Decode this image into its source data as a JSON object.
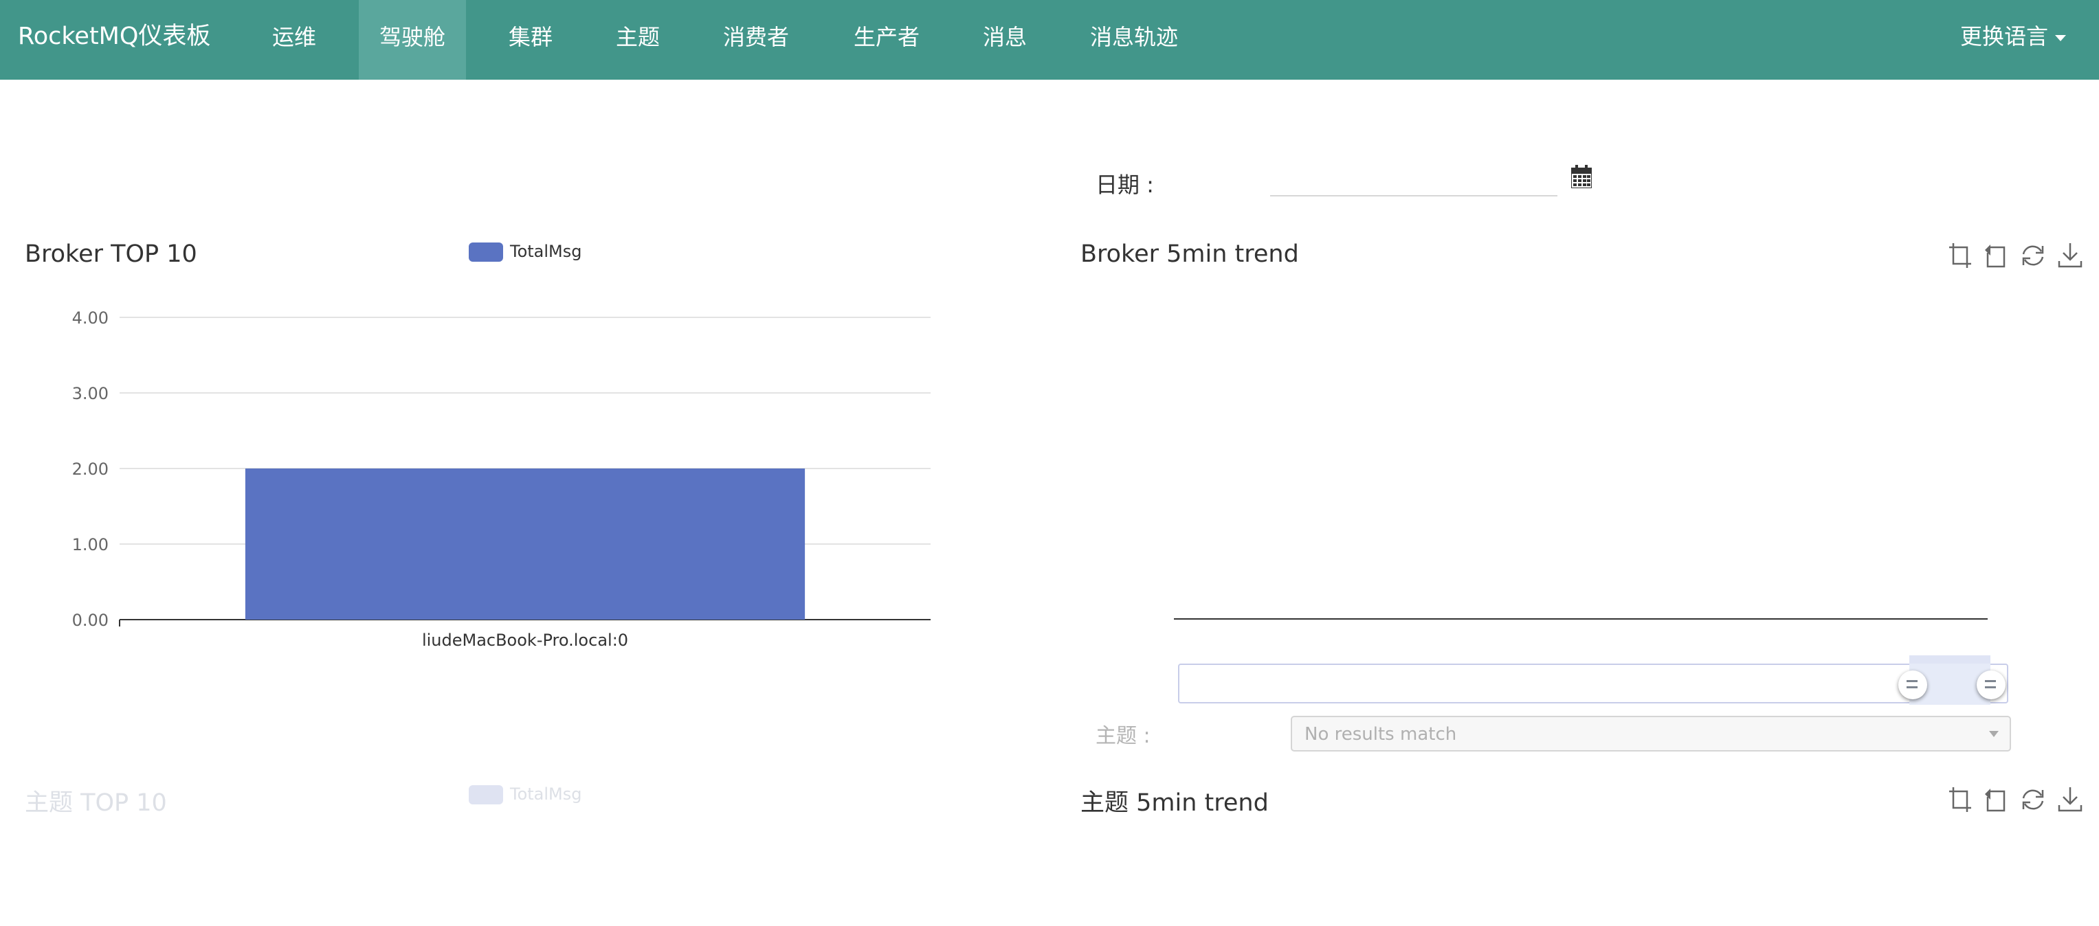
{
  "navbar": {
    "brand": "RocketMQ仪表板",
    "items": [
      "运维",
      "驾驶舱",
      "集群",
      "主题",
      "消费者",
      "生产者",
      "消息",
      "消息轨迹"
    ],
    "active": "驾驶舱",
    "language": "更换语言"
  },
  "date_filter": {
    "label": "日期 :",
    "value": ""
  },
  "broker_top10": {
    "title": "Broker TOP 10",
    "legend": "TotalMsg"
  },
  "broker_trend": {
    "title": "Broker 5min trend"
  },
  "topic_filter": {
    "label": "主题 :",
    "placeholder": "No results match"
  },
  "topic_top10": {
    "title": "主题 TOP 10",
    "legend": "TotalMsg"
  },
  "topic_trend": {
    "title": "主题 5min trend"
  },
  "toolbox_icons": [
    "data-zoom-icon",
    "data-zoom-reset-icon",
    "restore-icon",
    "download-icon"
  ],
  "colors": {
    "navbar": "#42968a",
    "navbar_active": "#5aa79d",
    "bar": "#5a73c2"
  },
  "chart_data": [
    {
      "type": "bar",
      "title": "Broker TOP 10",
      "categories": [
        "liudeMacBook-Pro.local:0"
      ],
      "series": [
        {
          "name": "TotalMsg",
          "values": [
            2
          ]
        }
      ],
      "ylim": [
        0,
        4
      ],
      "yticks": [
        "0.00",
        "1.00",
        "2.00",
        "3.00",
        "4.00"
      ],
      "grid": true,
      "legend_position": "top-center"
    },
    {
      "type": "line",
      "title": "Broker 5min trend",
      "series": [],
      "data_zoom": true
    }
  ]
}
